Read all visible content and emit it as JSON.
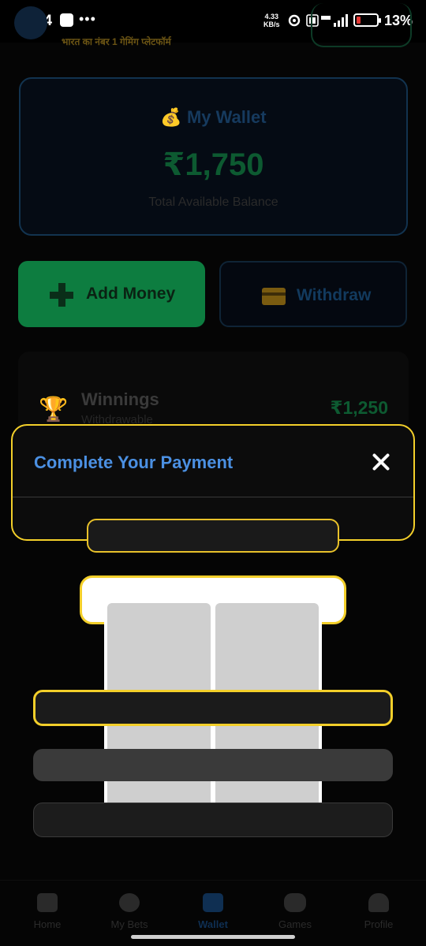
{
  "status_bar": {
    "time": "3:04",
    "dots": "•••",
    "net_speed_value": "4.33",
    "net_speed_unit": "KB/s",
    "battery_percent": "13%"
  },
  "header": {
    "tagline": "भारत का नंबर 1 गेमिंग प्लेटफॉर्म"
  },
  "wallet": {
    "title": "My Wallet",
    "title_icon": "money-bag-icon",
    "balance": "₹1,750",
    "balance_label": "Total Available Balance"
  },
  "actions": {
    "add_money": "Add Money",
    "withdraw": "Withdraw"
  },
  "winnings": {
    "title": "Winnings",
    "subtitle": "Withdrawable",
    "amount": "₹1,250"
  },
  "modal": {
    "title": "Complete Your Payment"
  },
  "bottom_nav": {
    "items": [
      {
        "label": "Home",
        "icon": "home-icon"
      },
      {
        "label": "My Bets",
        "icon": "list-icon"
      },
      {
        "label": "Wallet",
        "icon": "wallet-icon",
        "active": true
      },
      {
        "label": "Games",
        "icon": "gamepad-icon"
      },
      {
        "label": "Profile",
        "icon": "user-icon"
      }
    ]
  },
  "colors": {
    "modal_border": "#f3cf2a",
    "modal_title": "#4b90e2",
    "accent_green": "#0d7d40"
  }
}
